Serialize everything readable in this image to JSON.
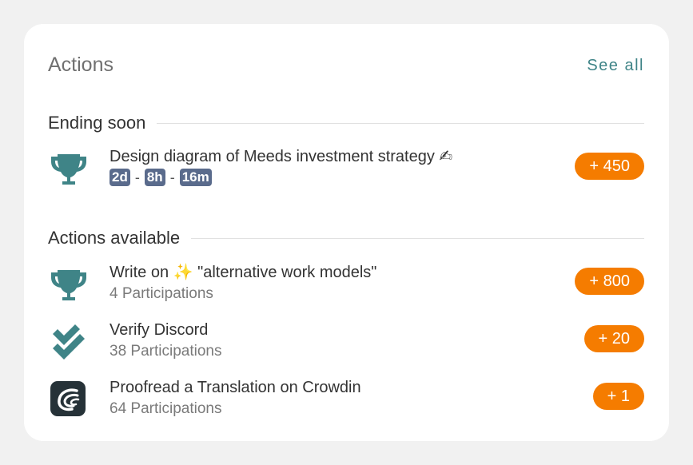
{
  "card": {
    "title": "Actions",
    "see_all": "See all"
  },
  "ending_soon": {
    "header": "Ending soon",
    "items": [
      {
        "title": "Design diagram of Meeds investment strategy ✍",
        "icon": "trophy-icon",
        "countdown": {
          "days": "2d",
          "hours": "8h",
          "minutes": "16m",
          "separator": "-"
        },
        "points": "+ 450"
      }
    ]
  },
  "available": {
    "header": "Actions available",
    "items": [
      {
        "title": "Write on ✨ \"alternative work models\"",
        "participations": "4 Participations",
        "points": "+ 800",
        "icon": "trophy-icon"
      },
      {
        "title": "Verify Discord",
        "participations": "38 Participations",
        "points": "+ 20",
        "icon": "double-check-icon"
      },
      {
        "title": "Proofread a Translation on Crowdin",
        "participations": "64 Participations",
        "points": "+ 1",
        "icon": "crowdin-icon"
      }
    ]
  },
  "colors": {
    "accent": "#3f8487",
    "points_badge": "#f57c00",
    "time_chip": "#5a6b8c"
  }
}
